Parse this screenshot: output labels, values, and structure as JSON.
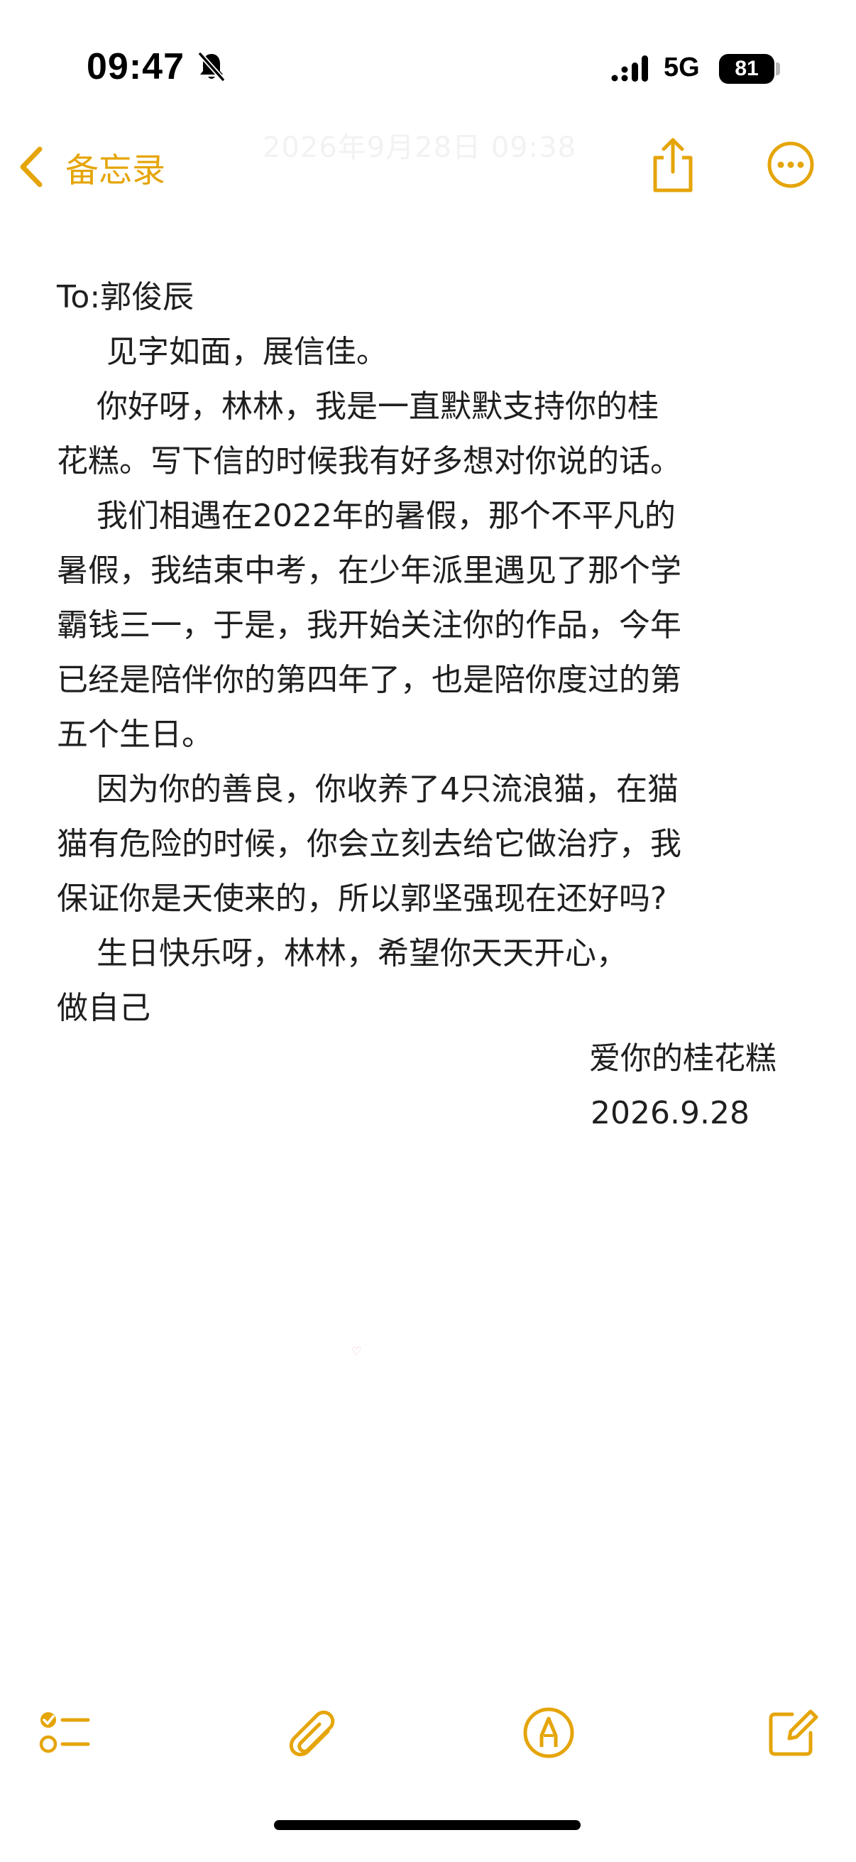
{
  "status_bar": {
    "time": "09:47",
    "network": "5G",
    "battery": "81",
    "icons": [
      "bell-slash-icon",
      "signal-icon"
    ]
  },
  "nav": {
    "back_label": "备忘录",
    "faint_timestamp": "2026年9月28日 09:38",
    "accent_color": "#e5a50a",
    "icons": [
      "chevron-left-icon",
      "share-icon",
      "more-icon"
    ]
  },
  "note": {
    "lines": [
      "To:郭俊辰",
      "     见字如面，展信佳。",
      "    你好呀，林林，我是一直默默支持你的桂",
      "花糕。写下信的时候我有好多想对你说的话。",
      "    我们相遇在2022年的暑假，那个不平凡的",
      "暑假，我结束中考，在少年派里遇见了那个学",
      "霸钱三一，于是，我开始关注你的作品，今年",
      "已经是陪伴你的第四年了，也是陪你度过的第",
      "五个生日。",
      "    因为你的善良，你收养了4只流浪猫，在猫",
      "猫有危险的时候，你会立刻去给它做治疗，我",
      "保证你是天使来的，所以郭坚强现在还好吗?",
      "    生日快乐呀，林林，希望你天天开心，",
      "做自己"
    ],
    "signature": "爱你的桂花糕",
    "date": "2026.9.28"
  },
  "toolbar": {
    "icons": [
      "checklist-icon",
      "paperclip-icon",
      "markup-pen-icon",
      "compose-icon"
    ]
  }
}
